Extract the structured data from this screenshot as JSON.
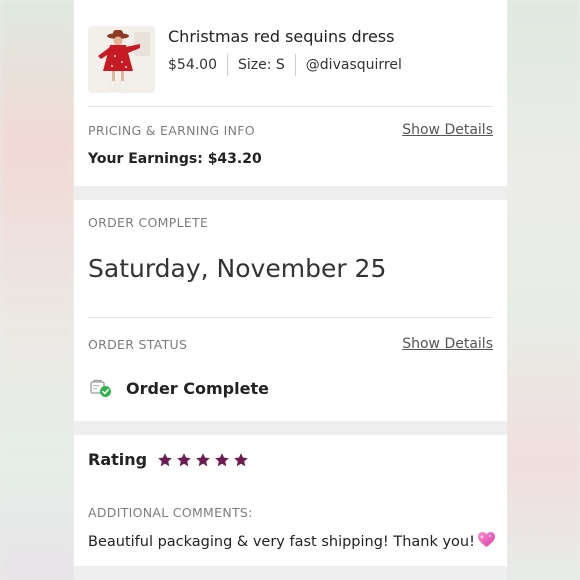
{
  "listing": {
    "title": "Christmas red sequins dress",
    "price": "$54.00",
    "size": "Size: S",
    "seller": "@divasquirrel",
    "image_icon": "dress-photo"
  },
  "pricing": {
    "section_label": "PRICING & EARNING INFO",
    "show_details": "Show Details",
    "earnings": "Your Earnings: $43.20"
  },
  "order": {
    "complete_label": "ORDER COMPLETE",
    "date": "Saturday, November 25",
    "status_label": "ORDER STATUS",
    "show_details": "Show Details",
    "status_text": "Order Complete",
    "status_icon": "order-complete-icon"
  },
  "rating": {
    "label": "Rating",
    "stars": 5,
    "max_stars": 5,
    "star_color": "#6b1d52",
    "comments_label": "ADDITIONAL COMMENTS:",
    "comment": "Beautiful packaging & very fast shipping! Thank you!",
    "comment_emoji": "sparkling-heart-icon"
  },
  "colors": {
    "accent_green": "#2fb34a",
    "text_dark": "#222222",
    "text_muted": "#7d7d7d"
  }
}
